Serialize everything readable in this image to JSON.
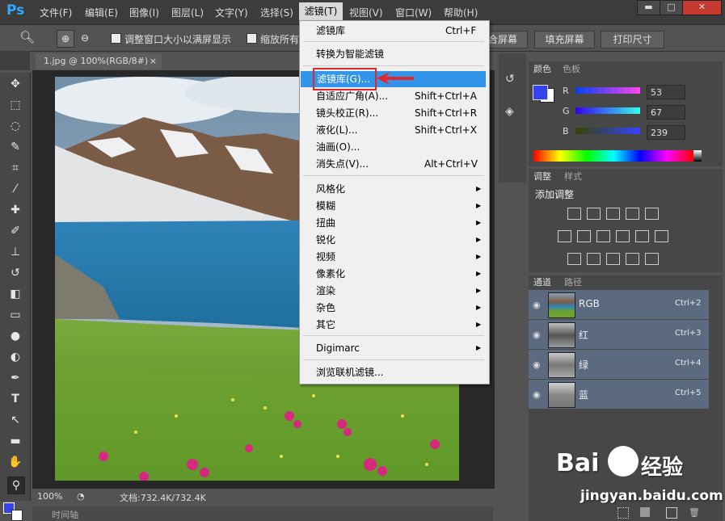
{
  "app": {
    "logo": "Ps"
  },
  "menubar": {
    "items": [
      "文件(F)",
      "编辑(E)",
      "图像(I)",
      "图层(L)",
      "文字(Y)",
      "选择(S)",
      "滤镜(T)",
      "视图(V)",
      "窗口(W)",
      "帮助(H)"
    ]
  },
  "window_controls": {
    "minimize": "▬",
    "restore": "□",
    "close": "✕"
  },
  "options": {
    "fit_window_label": "调整窗口大小以满屏显示",
    "zoom_all_label": "缩放所有",
    "fit_screen": "合屏幕",
    "fill_screen": "填充屏幕",
    "print_size": "打印尺寸"
  },
  "document": {
    "tab_title": "1.jpg @ 100%(RGB/8#)",
    "close": "×",
    "zoom": "100%",
    "doc_info": "文档:732.4K/732.4K",
    "timeline": "时间轴"
  },
  "filter_menu": {
    "items": [
      {
        "label": "滤镜库",
        "shortcut": "Ctrl+F"
      },
      {
        "label": "转换为智能滤镜"
      },
      {
        "label": "滤镜库(G)...",
        "highlight": true
      },
      {
        "label": "自适应广角(A)...",
        "shortcut": "Shift+Ctrl+A"
      },
      {
        "label": "镜头校正(R)...",
        "shortcut": "Shift+Ctrl+R"
      },
      {
        "label": "液化(L)...",
        "shortcut": "Shift+Ctrl+X"
      },
      {
        "label": "油画(O)..."
      },
      {
        "label": "消失点(V)...",
        "shortcut": "Alt+Ctrl+V"
      },
      {
        "label": "风格化",
        "submenu": true
      },
      {
        "label": "模糊",
        "submenu": true
      },
      {
        "label": "扭曲",
        "submenu": true
      },
      {
        "label": "锐化",
        "submenu": true
      },
      {
        "label": "视频",
        "submenu": true
      },
      {
        "label": "像素化",
        "submenu": true
      },
      {
        "label": "渲染",
        "submenu": true
      },
      {
        "label": "杂色",
        "submenu": true
      },
      {
        "label": "其它",
        "submenu": true
      },
      {
        "label": "Digimarc",
        "submenu": true
      },
      {
        "label": "浏览联机滤镜..."
      }
    ]
  },
  "color_panel": {
    "tab1": "颜色",
    "tab2": "色板",
    "r_label": "R",
    "g_label": "G",
    "b_label": "B",
    "r": "53",
    "g": "67",
    "b": "239",
    "foreground": "#3543ef"
  },
  "adjust_panel": {
    "tab1": "调整",
    "tab2": "样式",
    "title": "添加调整"
  },
  "channels_panel": {
    "tab1": "通道",
    "tab2": "路径",
    "rows": [
      {
        "name": "RGB",
        "key": "Ctrl+2"
      },
      {
        "name": "红",
        "key": "Ctrl+3"
      },
      {
        "name": "绿",
        "key": "Ctrl+4"
      },
      {
        "name": "蓝",
        "key": "Ctrl+5"
      }
    ]
  },
  "watermark": {
    "brand": "Bai",
    "brand2": "经验",
    "url": "jingyan.baidu.com"
  },
  "colors": {
    "accent": "#3395ea",
    "highlight_box": "#e0282e",
    "arrow": "#e0282e"
  }
}
